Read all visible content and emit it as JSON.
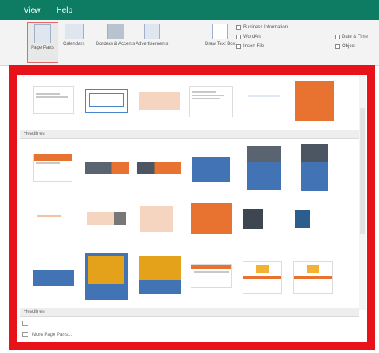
{
  "ribbon": {
    "tabs": [
      "",
      "View",
      "Help"
    ],
    "buttons": [
      "Page Parts",
      "Calendars",
      "Borders & Accents",
      "Advertisements",
      "Draw Text Box"
    ],
    "small": [
      "Business Information",
      "WordArt",
      "Insert File",
      "Date & Time",
      "Object"
    ]
  },
  "gallery": {
    "section_builtin": "",
    "section_headlines": "Headlines",
    "section_more": "Headlines",
    "more_link": "More Page Parts..."
  },
  "colors": {
    "accent_green": "#0e7b63",
    "highlight_red": "#e8131a",
    "orange": "#e8722f",
    "blue": "#4273b5"
  }
}
